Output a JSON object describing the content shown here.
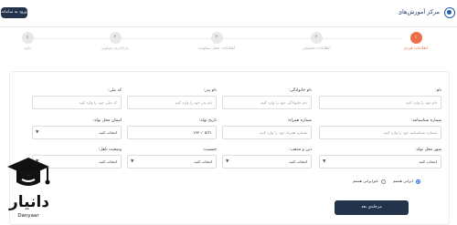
{
  "header": {
    "login_label": "ورود به سامانه",
    "logo_text": "مرکز آموزش‌های مجازی"
  },
  "steps": [
    {
      "number": "۱",
      "label": "اطلاعات فردی",
      "active": true
    },
    {
      "number": "۲",
      "label": "اطلاعات تحصیلی",
      "active": false
    },
    {
      "number": "۳",
      "label": "اطلاعات محل سکونت",
      "active": false
    },
    {
      "number": "۴",
      "label": "بارگذاری تصاویر",
      "active": false
    },
    {
      "number": "۵",
      "label": "تایید",
      "active": false
    }
  ],
  "form": {
    "first_name": {
      "label": "نام:",
      "placeholder": "نام خود را وارد کنید"
    },
    "last_name": {
      "label": "نام خانوادگی:",
      "placeholder": "نام خانوادگی خود را وارد کنید"
    },
    "father_name": {
      "label": "نام پدر:",
      "placeholder": "نام پدر خود را وارد کنید"
    },
    "national_code": {
      "label": "کد ملی:",
      "placeholder": "کد ملی خود را وارد کنید"
    },
    "id_number": {
      "label": "شماره شناسنامه:",
      "placeholder": "شماره شناسنامه خود را وارد کنید"
    },
    "mobile": {
      "label": "شماره همراه:",
      "placeholder": "شماره همراه خود را وارد کنید"
    },
    "birth_date": {
      "label": "تاریخ تولد:",
      "value": "۱۳۷۰/۰۵/۲۱"
    },
    "birth_province": {
      "label": "استان محل تولد:",
      "value": "انتخاب کنید"
    },
    "birth_city": {
      "label": "شهر محل تولد:",
      "value": "انتخاب کنید"
    },
    "religion": {
      "label": "دین و مذهب:",
      "value": "انتخاب کنید"
    },
    "gender": {
      "label": "جنسیت:",
      "value": "انتخاب کنید"
    },
    "marital_status": {
      "label": "وضعیت تاهل:",
      "value": "انتخاب کنید"
    },
    "radio_1": "ایرانی هستم",
    "radio_2": "غیرایرانی هستم"
  },
  "next_label": "مرحله‌ی بعد",
  "watermark": {
    "text": "دانیار",
    "sub": "Danyaar"
  },
  "colors": {
    "primary": "#23334c",
    "accent": "#ec6f4c"
  }
}
